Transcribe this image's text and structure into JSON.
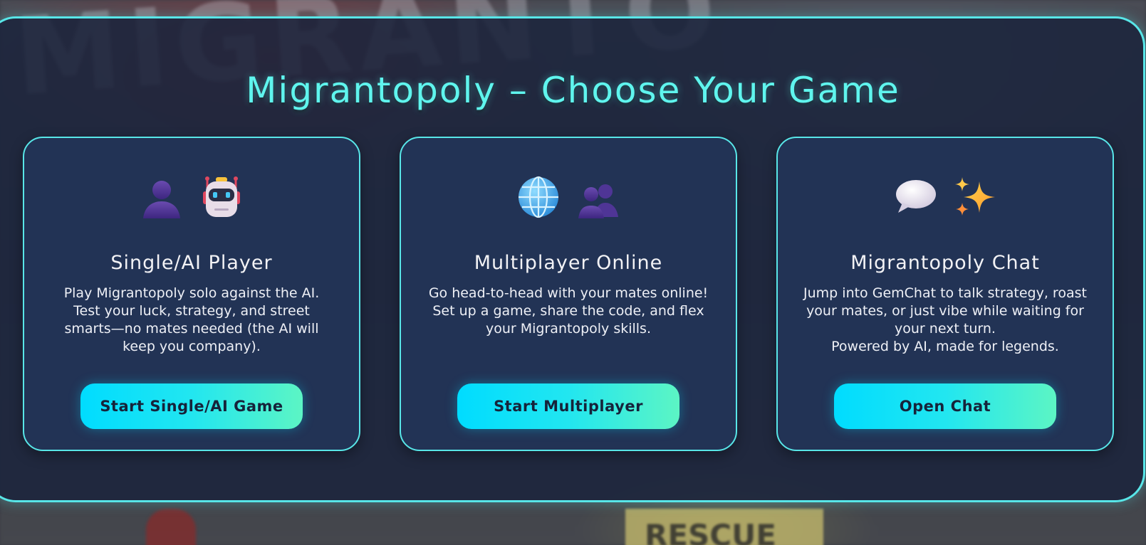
{
  "page": {
    "title": "Migrantopoly – Choose Your Game"
  },
  "cards": [
    {
      "title": "Single/AI Player",
      "description": "Play Migrantopoly solo against the AI.\nTest your luck, strategy, and street smarts—no mates needed (the AI will keep you company).",
      "button_label": "Start Single/AI Game",
      "icons": [
        "person-silhouette-icon",
        "robot-icon"
      ]
    },
    {
      "title": "Multiplayer Online",
      "description": "Go head-to-head with your mates online!\nSet up a game, share the code, and flex your Migrantopoly skills.",
      "button_label": "Start Multiplayer",
      "icons": [
        "globe-icon",
        "two-people-icon"
      ]
    },
    {
      "title": "Migrantopoly Chat",
      "description": "Jump into GemChat to talk strategy, roast your mates, or just vibe while waiting for your next turn.\nPowered by AI, made for legends.",
      "button_label": "Open Chat",
      "icons": [
        "speech-bubble-icon",
        "sparkles-icon"
      ]
    }
  ],
  "colors": {
    "accent": "#58e6e8",
    "title": "#5ff5ee",
    "panel": "#1b243c",
    "card": "#223355",
    "button_start": "#00dcff",
    "button_end": "#5cf5c4",
    "button_text": "#16233a"
  }
}
